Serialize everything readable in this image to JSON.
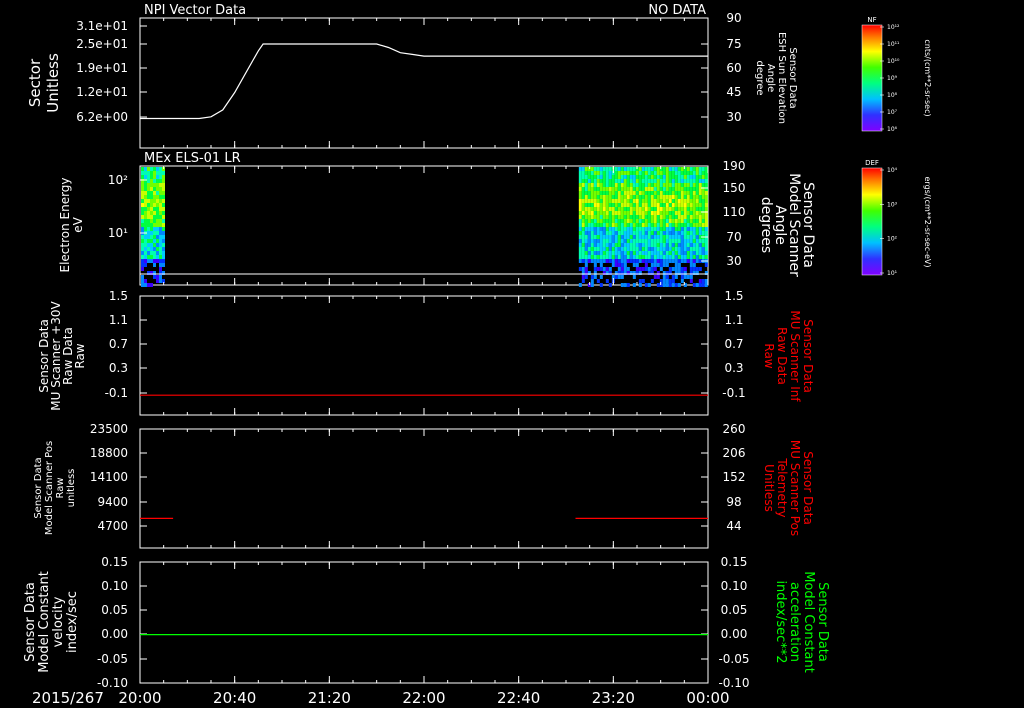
{
  "chart_data": [
    {
      "type": "line",
      "title": "NPI Vector Data",
      "status": "NO DATA",
      "ylabel": [
        "Sector",
        "Unitless"
      ],
      "y_ticks": [
        "3.1e+01",
        "2.5e+01",
        "1.9e+01",
        "1.2e+01",
        "6.2e+00"
      ],
      "right_label": [
        "Sensor Data",
        "ESH Sun Elevation",
        "Angle",
        "degree"
      ],
      "right_ticks": [
        "90",
        "75",
        "60",
        "45",
        "30"
      ],
      "line_color": "#ffffff",
      "series": [
        {
          "x": [
            "20:00",
            "20:25",
            "20:30",
            "20:35",
            "20:40",
            "20:45",
            "20:50",
            "20:52",
            "21:40",
            "21:45",
            "21:50",
            "21:55",
            "22:00",
            "00:00"
          ],
          "values": [
            37,
            37,
            38,
            42,
            52,
            64,
            76,
            80,
            80,
            78,
            75,
            74,
            73,
            73
          ]
        }
      ]
    },
    {
      "type": "heatmap",
      "title": "MEx ELS-01 LR",
      "ylabel": [
        "Electron Energy",
        "eV"
      ],
      "y_ticks": [
        "10²",
        "10¹"
      ],
      "right_label": [
        "Sensor Data",
        "Model Scanner",
        "Angle",
        "degrees"
      ],
      "right_ticks": [
        "190",
        "150",
        "110",
        "70",
        "30"
      ],
      "data_windows": [
        [
          "20:00",
          "20:10"
        ],
        [
          "23:05",
          "00:00"
        ]
      ]
    },
    {
      "type": "line",
      "ylabel": [
        "Sensor Data",
        "MU Scanner +30V",
        "Raw Data",
        "Raw"
      ],
      "y_ticks": [
        "1.5",
        "1.1",
        "0.7",
        "0.3",
        "-0.1"
      ],
      "right_label": [
        "Sensor Data",
        "MU Scanner Inf",
        "Raw Data",
        "Raw"
      ],
      "right_ticks": [
        "1.5",
        "1.1",
        "0.7",
        "0.3",
        "-0.1"
      ],
      "line_color": "#ff0000",
      "series": [
        {
          "x": [
            "20:00",
            "00:00"
          ],
          "values": [
            0.0,
            0.0
          ]
        }
      ]
    },
    {
      "type": "line",
      "ylabel": [
        "Sensor Data",
        "Model Scanner Pos",
        "Raw",
        "unitless"
      ],
      "y_ticks": [
        "23500",
        "18800",
        "14100",
        "9400",
        "4700"
      ],
      "right_label": [
        "Sensor Data",
        "MU Scanner Pos",
        "Telemetry",
        "Unitless"
      ],
      "right_ticks": [
        "260",
        "206",
        "152",
        "98",
        "44"
      ],
      "line_color": "#ff0000",
      "series": [
        {
          "x": [
            "20:00",
            "20:14"
          ],
          "values": [
            8100,
            8100
          ]
        },
        {
          "x": [
            "23:04",
            "00:00"
          ],
          "values": [
            8100,
            8100
          ]
        }
      ]
    },
    {
      "type": "line",
      "ylabel": [
        "Sensor Data",
        "Model Constant",
        "velocity",
        "index/sec"
      ],
      "y_ticks": [
        "0.15",
        "0.10",
        "0.05",
        "0.00",
        "-0.05",
        "-0.10"
      ],
      "right_label": [
        "Sensor Data",
        "Model Constant",
        "acceleration",
        "index/sec**2"
      ],
      "right_ticks": [
        "0.15",
        "0.10",
        "0.05",
        "0.00",
        "-0.05",
        "-0.10"
      ],
      "line_color": "#00ff00",
      "series": [
        {
          "x": [
            "20:00",
            "00:00"
          ],
          "values": [
            0.0,
            0.0
          ]
        }
      ]
    }
  ],
  "time_axis": {
    "date": "2015/267",
    "ticks": [
      "20:00",
      "20:40",
      "21:20",
      "22:00",
      "22:40",
      "23:20",
      "00:00"
    ]
  },
  "colorbars": [
    {
      "name": "NF",
      "unit": "cnts/(cm**2-sr-sec)",
      "tick_labels": [
        "10¹²",
        "10¹¹",
        "10¹⁰",
        "10⁹",
        "10⁸",
        "10⁷",
        "10⁶"
      ]
    },
    {
      "name": "DEF",
      "unit": "ergs/(cm**2-sr-sec-eV)",
      "tick_labels": [
        "10⁴",
        "10³",
        "10²",
        "10¹"
      ]
    }
  ],
  "colors": {
    "background": "#000000",
    "axes": "#ffffff",
    "red_panel_label": "#ff0000",
    "green_panel_label": "#00ff00"
  }
}
